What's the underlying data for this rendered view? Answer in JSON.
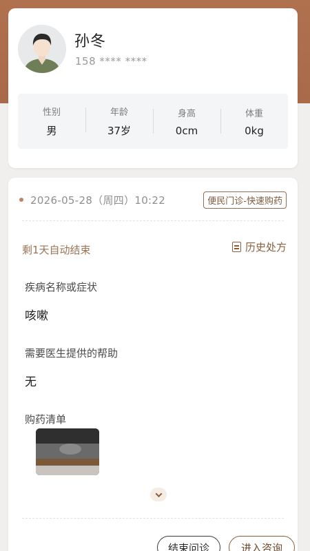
{
  "patient": {
    "name": "孙冬",
    "phone": "158 **** ****"
  },
  "stats": [
    {
      "label": "性别",
      "value": "男"
    },
    {
      "label": "年龄",
      "value": "37岁"
    },
    {
      "label": "身高",
      "value": "0cm"
    },
    {
      "label": "体重",
      "value": "0kg"
    }
  ],
  "consultation": {
    "datetime": "2026-05-28（周四）10:22",
    "tag": "便民门诊-快速购药",
    "remaining": "剩1天自动结束",
    "history_label": "历史处方",
    "disease_label": "疾病名称或症状",
    "disease_value": "咳嗽",
    "help_label": "需要医生提供的帮助",
    "help_value": "无",
    "drug_list_label": "购药清单"
  },
  "actions": {
    "end_label": "结束问诊",
    "enter_label": "进入咨询"
  },
  "colors": {
    "accent": "#8a5e3c",
    "header_bg": "#b0714f"
  }
}
